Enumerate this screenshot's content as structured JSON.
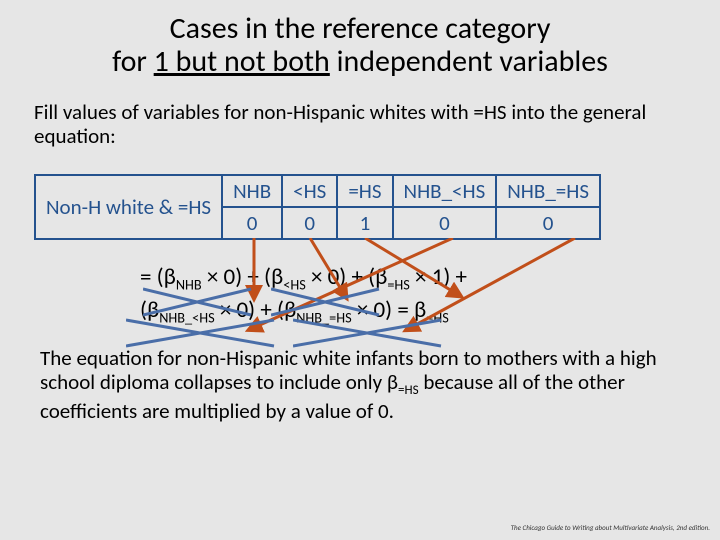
{
  "title": {
    "line1": "Cases in the reference category",
    "line2_a": "for ",
    "line2_u": "1 but not both",
    "line2_b": " independent variables"
  },
  "intro": "Fill values of variables for non-Hispanic whites with =HS into the general equation:",
  "table": {
    "rowlabel": "Non-H white & =HS",
    "headers": [
      "NHB",
      "<HS",
      "=HS",
      "NHB_<HS",
      "NHB_=HS"
    ],
    "values": [
      "0",
      "0",
      "1",
      "0",
      "0"
    ]
  },
  "equation": {
    "line1_parts": [
      {
        "t": "= (β"
      },
      {
        "sub": "NHB"
      },
      {
        "t": " × 0) + (β"
      },
      {
        "sub": "<HS"
      },
      {
        "t": " × 0) + (β"
      },
      {
        "sub": "=HS"
      },
      {
        "t": " × 1) +"
      }
    ],
    "line2_parts": [
      {
        "t": "(β"
      },
      {
        "sub": "NHB_<HS"
      },
      {
        "t": " × 0) + (β"
      },
      {
        "sub": "NHB_=HS"
      },
      {
        "t": " × 0) = β"
      },
      {
        "sub": "=HS"
      }
    ]
  },
  "body2_parts": [
    {
      "t": "The equation for non-Hispanic white infants born to mothers with a high school diploma collapses to include only β"
    },
    {
      "sub": "=HS"
    },
    {
      "t": " because all of the other coefficients are multiplied by a value of 0."
    }
  ],
  "footnote": "The Chicago Guide to Writing about Multivariate Analysis, 2nd edition.",
  "colors": {
    "arrow": "#c14f1a",
    "cross": "#4a6ea8"
  }
}
